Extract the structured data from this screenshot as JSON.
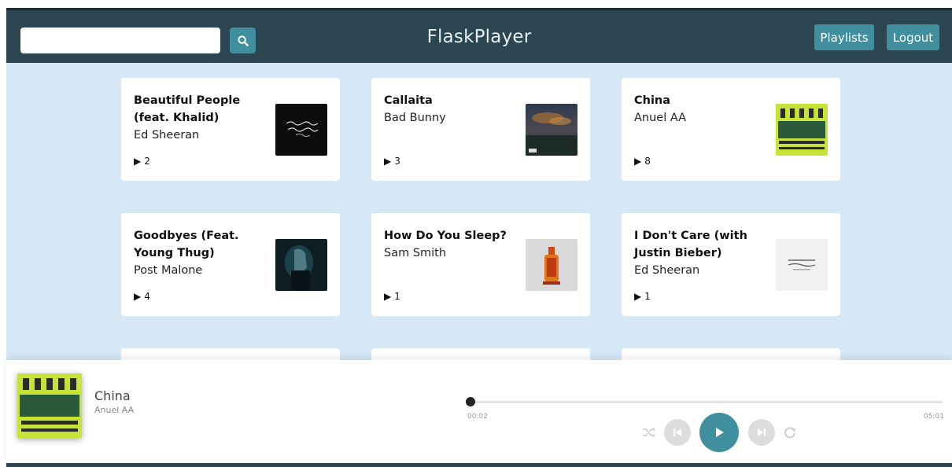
{
  "header": {
    "brand": "FlaskPlayer",
    "search": {
      "value": "",
      "placeholder": ""
    },
    "buttons": {
      "playlists": "Playlists",
      "logout": "Logout"
    }
  },
  "songs": [
    {
      "title": "Beautiful People (feat. Khalid)",
      "artist": "Ed Sheeran",
      "plays": "2",
      "cover": "beautiful-people-cover"
    },
    {
      "title": "Callaita",
      "artist": "Bad Bunny",
      "plays": "3",
      "cover": "callaita-cover"
    },
    {
      "title": "China",
      "artist": "Anuel AA",
      "plays": "8",
      "cover": "china-cover"
    },
    {
      "title": "Goodbyes (Feat. Young Thug)",
      "artist": "Post Malone",
      "plays": "4",
      "cover": "goodbyes-cover"
    },
    {
      "title": "How Do You Sleep?",
      "artist": "Sam Smith",
      "plays": "1",
      "cover": "how-do-you-sleep-cover"
    },
    {
      "title": "I Don't Care (with Justin Bieber)",
      "artist": "Ed Sheeran",
      "plays": "1",
      "cover": "i-dont-care-cover"
    }
  ],
  "player": {
    "title": "China",
    "artist": "Anuel AA",
    "current_time": "00:02",
    "duration": "05:01",
    "progress": 0.007
  },
  "icons": {
    "search": "search-icon",
    "play_count": "play-triangle-icon",
    "shuffle": "shuffle-icon",
    "previous": "previous-icon",
    "play": "play-icon",
    "next": "next-icon",
    "repeat": "repeat-icon"
  },
  "colors": {
    "navbar": "#2b4650",
    "accent": "#3f8f9e",
    "content_bg": "#d6e8f5"
  }
}
